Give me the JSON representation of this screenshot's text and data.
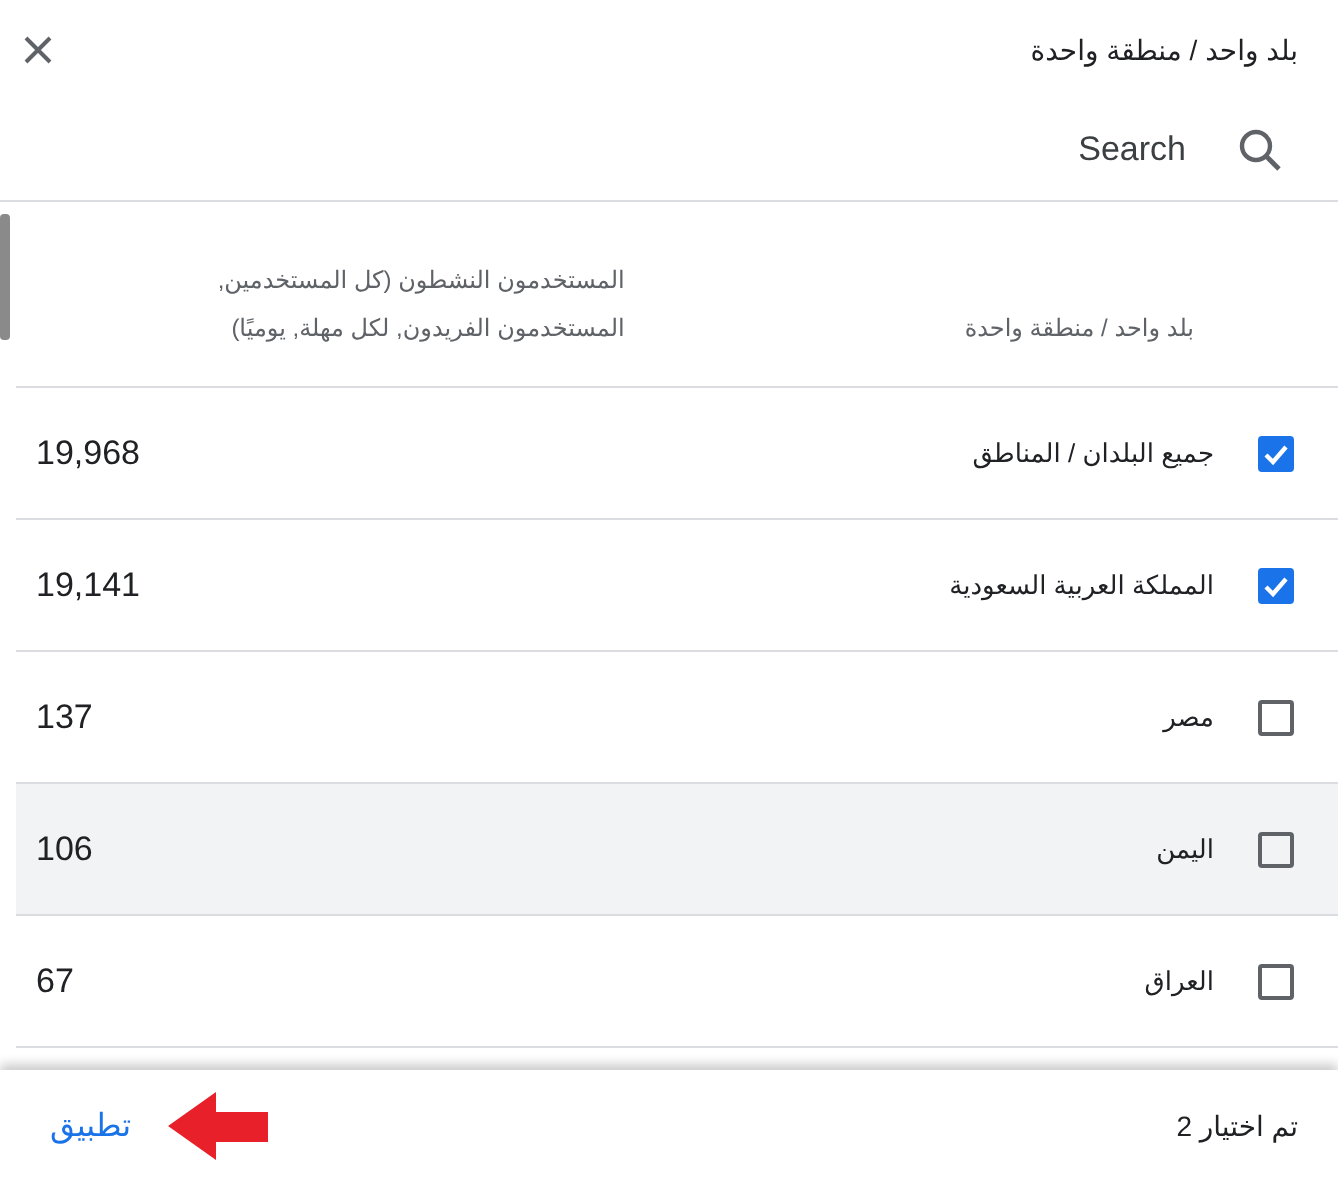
{
  "dialog": {
    "title": "بلد واحد / منطقة واحدة"
  },
  "search": {
    "placeholder": "Search"
  },
  "table": {
    "columns": [
      {
        "label": "بلد واحد / منطقة واحدة"
      },
      {
        "label": "المستخدمون النشطون (كل المستخدمين, المستخدمون الفريدون, لكل مهلة, يوميًا)"
      }
    ],
    "rows": [
      {
        "name": "جميع البلدان / المناطق",
        "value": "19,968",
        "checked": true,
        "highlighted": false
      },
      {
        "name": "المملكة العربية السعودية",
        "value": "19,141",
        "checked": true,
        "highlighted": false
      },
      {
        "name": "مصر",
        "value": "137",
        "checked": false,
        "highlighted": false
      },
      {
        "name": "اليمن",
        "value": "106",
        "checked": false,
        "highlighted": true
      },
      {
        "name": "العراق",
        "value": "67",
        "checked": false,
        "highlighted": false
      }
    ]
  },
  "footer": {
    "selection_count": "تم اختيار 2",
    "apply": "تطبيق"
  }
}
